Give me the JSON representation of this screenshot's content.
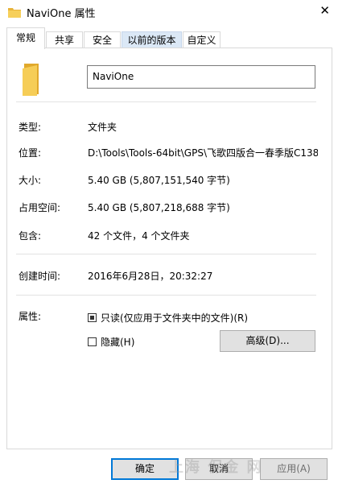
{
  "window": {
    "title": "NaviOne 属性",
    "close_glyph": "✕"
  },
  "tabs": [
    {
      "label": "常规",
      "state": "active"
    },
    {
      "label": "共享",
      "state": "normal"
    },
    {
      "label": "安全",
      "state": "normal"
    },
    {
      "label": "以前的版本",
      "state": "hover"
    },
    {
      "label": "自定义",
      "state": "normal"
    }
  ],
  "general": {
    "name_value": "NaviOne",
    "type_label": "类型:",
    "type_value": "文件夹",
    "location_label": "位置:",
    "location_value": "D:\\Tools\\Tools-64bit\\GPS\\飞歌四版合一春季版C138",
    "size_label": "大小:",
    "size_value": "5.40 GB (5,807,151,540 字节)",
    "disk_size_label": "占用空间:",
    "disk_size_value": "5.40 GB (5,807,218,688 字节)",
    "contains_label": "包含:",
    "contains_value": "42 个文件，4 个文件夹",
    "created_label": "创建时间:",
    "created_value": "2016年6月28日，20:32:27",
    "attributes_label": "属性:",
    "readonly_label": "只读(仅应用于文件夹中的文件)(R)",
    "hidden_label": "隐藏(H)",
    "advanced_button": "高级(D)..."
  },
  "buttons": {
    "ok": "确定",
    "cancel": "取消",
    "apply": "应用(A)"
  },
  "watermark": "上海 保金 网",
  "colors": {
    "folder": "#f0c24b",
    "tab_hover": "#dbe8f6",
    "default_border": "#0078d7"
  }
}
